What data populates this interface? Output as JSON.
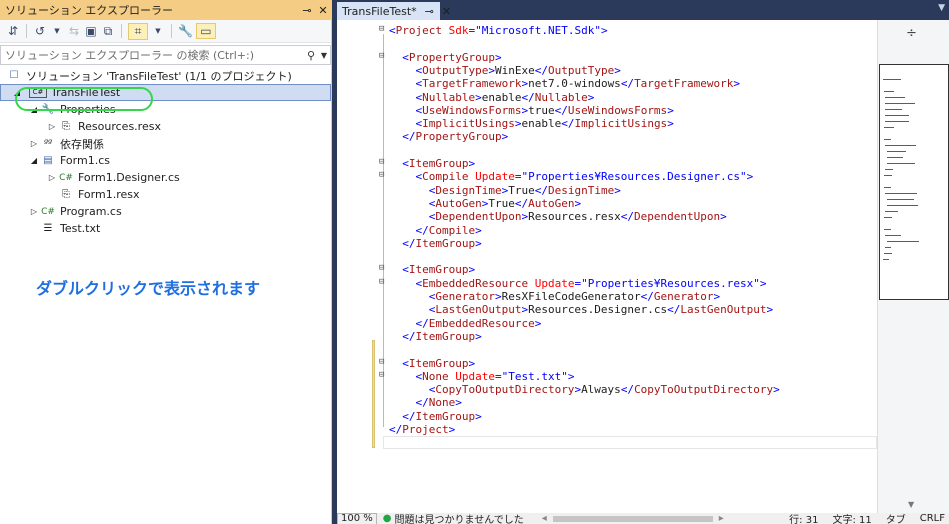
{
  "solution_explorer": {
    "title": "ソリューション エクスプローラー",
    "pin_glyph": "⊸",
    "close_glyph": "✕",
    "search_placeholder": "ソリューション エクスプローラー の検索 (Ctrl+:)",
    "tree": [
      {
        "label": "ソリューション 'TransFileTest' (1/1 のプロジェクト)",
        "icon": "solution-icon",
        "glyph": "☐",
        "expander": ""
      },
      {
        "label": "TransFileTest",
        "icon": "project-icon",
        "glyph": "C#",
        "expander": "◢"
      },
      {
        "label": "Properties",
        "icon": "wrench-icon",
        "glyph": "🔧",
        "expander": "◢"
      },
      {
        "label": "Resources.resx",
        "icon": "resx-icon",
        "glyph": "⎘",
        "expander": "▷"
      },
      {
        "label": "依存関係",
        "icon": "dependency-icon",
        "glyph": "ᵒᵒ",
        "expander": "▷"
      },
      {
        "label": "Form1.cs",
        "icon": "form-icon",
        "glyph": "▤",
        "expander": "◢"
      },
      {
        "label": "Form1.Designer.cs",
        "icon": "csharp-file-icon",
        "glyph": "C#",
        "expander": "▷"
      },
      {
        "label": "Form1.resx",
        "icon": "resx-icon",
        "glyph": "⎘",
        "expander": ""
      },
      {
        "label": "Program.cs",
        "icon": "csharp-file-icon",
        "glyph": "C#",
        "expander": "▷"
      },
      {
        "label": "Test.txt",
        "icon": "text-file-icon",
        "glyph": "☰",
        "expander": ""
      }
    ],
    "note": "ダブルクリックで表示されます"
  },
  "editor": {
    "tab_label": "TransFileTest*",
    "tab_pin": "⊸",
    "tab_close": "✕",
    "lines": [
      [
        "<",
        "Project",
        " Sdk",
        "=\"Microsoft.NET.Sdk\"",
        ">"
      ],
      [
        ""
      ],
      [
        "  <",
        "PropertyGroup",
        ">"
      ],
      [
        "    <",
        "OutputType",
        ">",
        "WinExe",
        "</",
        "OutputType",
        ">"
      ],
      [
        "    <",
        "TargetFramework",
        ">",
        "net7.0-windows",
        "</",
        "TargetFramework",
        ">"
      ],
      [
        "    <",
        "Nullable",
        ">",
        "enable",
        "</",
        "Nullable",
        ">"
      ],
      [
        "    <",
        "UseWindowsForms",
        ">",
        "true",
        "</",
        "UseWindowsForms",
        ">"
      ],
      [
        "    <",
        "ImplicitUsings",
        ">",
        "enable",
        "</",
        "ImplicitUsings",
        ">"
      ],
      [
        "  </",
        "PropertyGroup",
        ">"
      ],
      [
        ""
      ],
      [
        "  <",
        "ItemGroup",
        ">"
      ],
      [
        "    <",
        "Compile",
        " Update",
        "=\"Properties¥Resources.Designer.cs\"",
        ">"
      ],
      [
        "      <",
        "DesignTime",
        ">",
        "True",
        "</",
        "DesignTime",
        ">"
      ],
      [
        "      <",
        "AutoGen",
        ">",
        "True",
        "</",
        "AutoGen",
        ">"
      ],
      [
        "      <",
        "DependentUpon",
        ">",
        "Resources.resx",
        "</",
        "DependentUpon",
        ">"
      ],
      [
        "    </",
        "Compile",
        ">"
      ],
      [
        "  </",
        "ItemGroup",
        ">"
      ],
      [
        ""
      ],
      [
        "  <",
        "ItemGroup",
        ">"
      ],
      [
        "    <",
        "EmbeddedResource",
        " Update",
        "=\"Properties¥Resources.resx\"",
        ">"
      ],
      [
        "      <",
        "Generator",
        ">",
        "ResXFileCodeGenerator",
        "</",
        "Generator",
        ">"
      ],
      [
        "      <",
        "LastGenOutput",
        ">",
        "Resources.Designer.cs",
        "</",
        "LastGenOutput",
        ">"
      ],
      [
        "    </",
        "EmbeddedResource",
        ">"
      ],
      [
        "  </",
        "ItemGroup",
        ">"
      ],
      [
        ""
      ],
      [
        "  <",
        "ItemGroup",
        ">"
      ],
      [
        "    <",
        "None",
        " Update",
        "=\"Test.txt\"",
        ">"
      ],
      [
        "      <",
        "CopyToOutputDirectory",
        ">",
        "Always",
        "</",
        "CopyToOutputDirectory",
        ">"
      ],
      [
        "    </",
        "None",
        ">"
      ],
      [
        "  </",
        "ItemGroup",
        ">"
      ],
      [
        "</",
        "Project",
        ">"
      ]
    ]
  },
  "status": {
    "zoom": "100 %",
    "issues": "問題は見つかりませんでした",
    "line": "行: 31",
    "char": "文字: 11",
    "tab": "タブ",
    "eol": "CRLF"
  }
}
